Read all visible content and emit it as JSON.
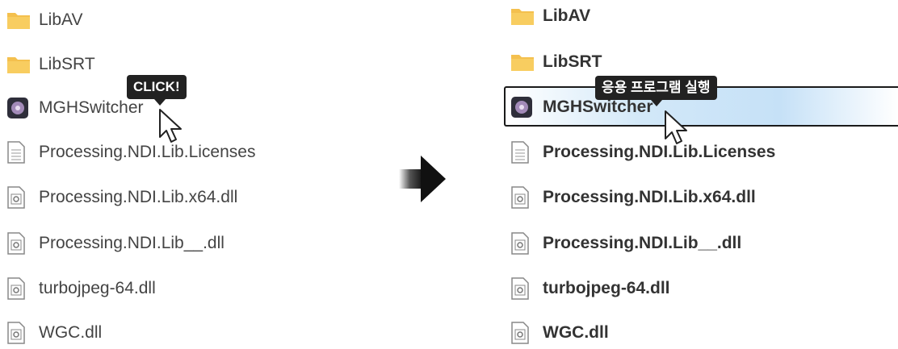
{
  "left": {
    "items": [
      {
        "label": "LibAV",
        "icon": "folder-icon"
      },
      {
        "label": "LibSRT",
        "icon": "folder-icon"
      },
      {
        "label": "MGHSwitcher",
        "icon": "app-icon"
      },
      {
        "label": "Processing.NDI.Lib.Licenses",
        "icon": "text-file-icon"
      },
      {
        "label": "Processing.NDI.Lib.x64.dll",
        "icon": "dll-file-icon"
      },
      {
        "label": "Processing.NDI.Lib__.dll",
        "icon": "dll-file-icon"
      },
      {
        "label": "turbojpeg-64.dll",
        "icon": "dll-file-icon"
      },
      {
        "label": "WGC.dll",
        "icon": "dll-file-icon"
      }
    ],
    "tooltip": "CLICK!"
  },
  "right": {
    "items": [
      {
        "label": "LibAV",
        "icon": "folder-icon"
      },
      {
        "label": "LibSRT",
        "icon": "folder-icon"
      },
      {
        "label": "MGHSwitcher",
        "icon": "app-icon",
        "selected": true
      },
      {
        "label": "Processing.NDI.Lib.Licenses",
        "icon": "text-file-icon"
      },
      {
        "label": "Processing.NDI.Lib.x64.dll",
        "icon": "dll-file-icon"
      },
      {
        "label": "Processing.NDI.Lib__.dll",
        "icon": "dll-file-icon"
      },
      {
        "label": "turbojpeg-64.dll",
        "icon": "dll-file-icon"
      },
      {
        "label": "WGC.dll",
        "icon": "dll-file-icon"
      }
    ],
    "tooltip": "응용 프로그램 실행"
  },
  "colors": {
    "folder": "#f4c04e",
    "selection": "#c6e1f7",
    "tooltip_bg": "#222222"
  }
}
